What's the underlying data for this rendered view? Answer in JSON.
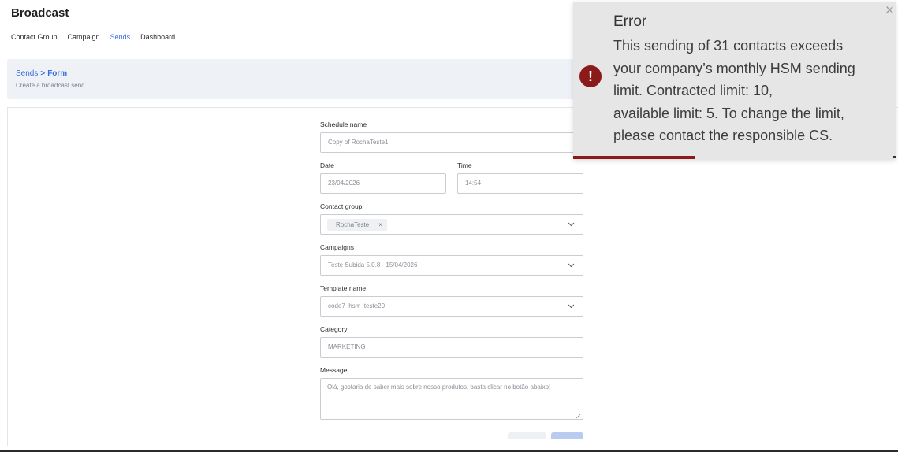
{
  "header": {
    "title": "Broadcast"
  },
  "tabs": [
    {
      "label": "Contact Group",
      "active": false
    },
    {
      "label": "Campaign",
      "active": false
    },
    {
      "label": "Sends",
      "active": true
    },
    {
      "label": "Dashboard",
      "active": false
    }
  ],
  "breadcrumb": {
    "parent": "Sends",
    "separator": ">",
    "current": "Form",
    "subtitle": "Create a broadcast send"
  },
  "form": {
    "schedule_name": {
      "label": "Schedule name",
      "value": "Copy of  RochaTeste1"
    },
    "date": {
      "label": "Date",
      "value": "23/04/2026"
    },
    "time": {
      "label": "Time",
      "value": "14:54"
    },
    "contact_group": {
      "label": "Contact group",
      "chip": "RochaTeste",
      "chip_remove": "×"
    },
    "campaigns": {
      "label": "Campaigns",
      "value": "Teste Subida 5.0.8 - 15/04/2026"
    },
    "template_name": {
      "label": "Template name",
      "value": "code7_hsm_teste20"
    },
    "category": {
      "label": "Category",
      "value": "MARKETING"
    },
    "message": {
      "label": "Message",
      "value": "Olá, gostaria de saber mais sobre nosso produtos, basta clicar no botão abaixo!"
    }
  },
  "toast": {
    "icon_glyph": "!",
    "close_glyph": "×",
    "title": "Error",
    "lines": [
      "This sending of 31 contacts exceeds",
      "your company’s monthly HSM sending",
      "limit. Contracted limit: 10,",
      "available limit: 5. To change the limit,",
      "please contact the responsible CS."
    ],
    "progress_fraction": 0.38,
    "accent_color": "#8b1a1a"
  },
  "colors": {
    "primary": "#3a6fd8",
    "error": "#8b1a1a",
    "panel": "#eef2f7"
  }
}
